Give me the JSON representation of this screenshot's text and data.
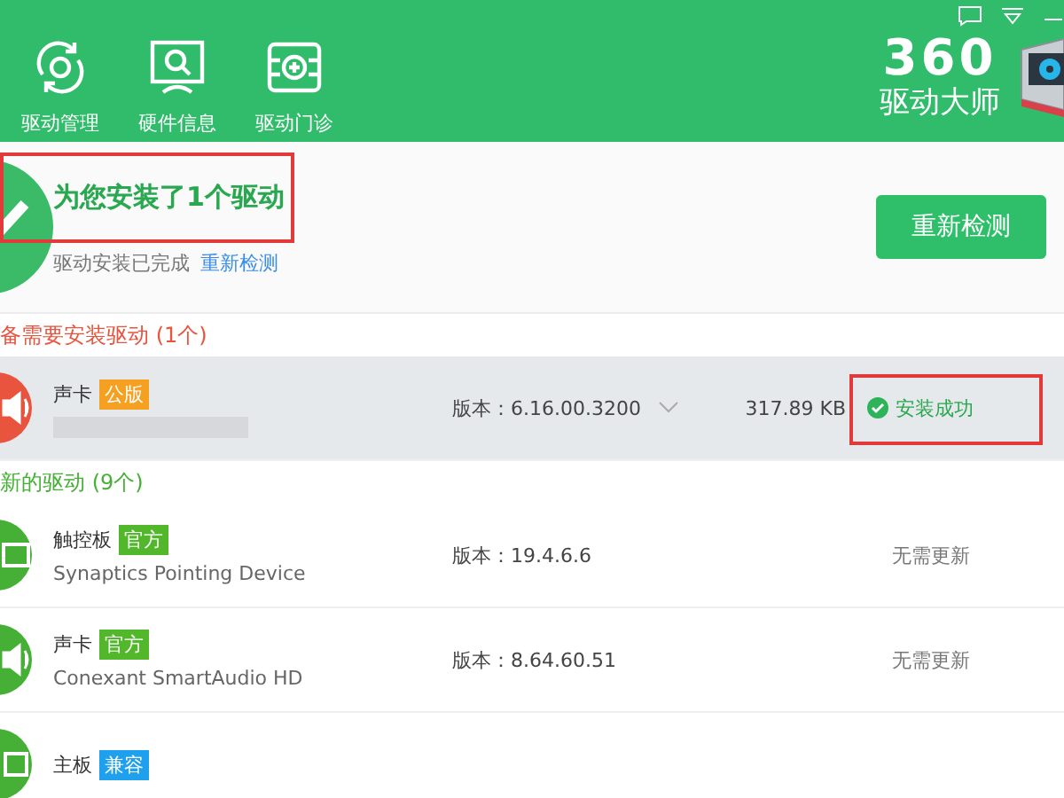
{
  "toolbar": {
    "items": [
      {
        "label": "驱动管理",
        "kind": "refresh"
      },
      {
        "label": "硬件信息",
        "kind": "monitor"
      },
      {
        "label": "驱动门诊",
        "kind": "clinic"
      }
    ]
  },
  "logo": {
    "number": "360",
    "name": "驱动大师"
  },
  "summary": {
    "title": "为您安装了1个驱动",
    "title_highlighted": true,
    "status": "驱动安装已完成",
    "link": "重新检测",
    "button": "重新检测"
  },
  "sections": [
    {
      "heading": "备需要安装驱动 (1个)",
      "color": "#e8543e",
      "rows": [
        {
          "kind": "speaker",
          "name": "声卡",
          "tag": "公版",
          "color": "#f5a020",
          "version": "版本：6.16.00.3200",
          "size": "317.89 KB",
          "status": "安装成功",
          "success": true,
          "highlighted": true,
          "selected": true
        }
      ]
    },
    {
      "heading": "新的驱动 (9个)",
      "color": "#45b035",
      "rows": [
        {
          "kind": "touchpad",
          "name": "触控板",
          "tag": "官方",
          "color": "#52b72a",
          "subtitle": "Synaptics Pointing Device",
          "version": "版本：19.4.6.6",
          "status": "无需更新",
          "success": false,
          "highlighted": false,
          "selected": false
        },
        {
          "kind": "speaker",
          "name": "声卡",
          "tag": "官方",
          "color": "#52b72a",
          "subtitle": "Conexant SmartAudio HD",
          "version": "版本：8.64.60.51",
          "status": "无需更新",
          "success": false,
          "highlighted": false,
          "selected": false
        },
        {
          "kind": "board",
          "name": "主板",
          "tag": "兼容",
          "color": "#1ea0ee",
          "selected": false
        }
      ]
    }
  ]
}
